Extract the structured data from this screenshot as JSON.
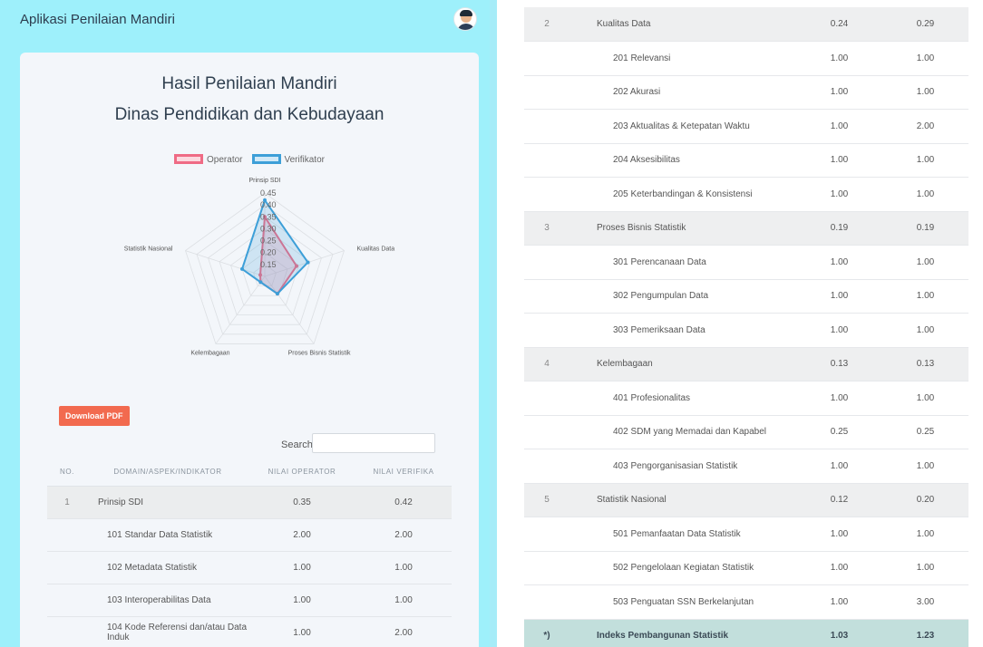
{
  "app": {
    "title": "Aplikasi Penilaian Mandiri"
  },
  "header": {
    "title_line1": "Hasil Penilaian Mandiri",
    "title_line2": "Dinas Pendidikan dan Kebudayaan"
  },
  "chart_data": {
    "type": "radar",
    "categories": [
      "Prinsip SDI",
      "Kualitas Data",
      "Proses Bisnis Statistik",
      "Kelembagaan",
      "Statistik Nasional"
    ],
    "series": [
      {
        "name": "Operator",
        "values": [
          0.35,
          0.24,
          0.19,
          0.13,
          0.12
        ],
        "color": "#ef6b85"
      },
      {
        "name": "Verifikator",
        "values": [
          0.42,
          0.29,
          0.19,
          0.13,
          0.2
        ],
        "color": "#3d9fd8"
      }
    ],
    "r_ticks": [
      "0.45",
      "0.40",
      "0.35",
      "0.30",
      "0.25",
      "0.20",
      "0.15"
    ],
    "r_range": [
      0.1,
      0.45
    ],
    "legend_position": "top"
  },
  "toolbar": {
    "download_label": "Download PDF",
    "search_label": "Search:"
  },
  "table": {
    "headers": [
      "NO.",
      "DOMAIN/ASPEK/INDIKATOR",
      "NILAI OPERATOR",
      "NILAI VERIFIKA"
    ],
    "left_rows": [
      {
        "type": "domain",
        "no": "1",
        "name": "Prinsip SDI",
        "op": "0.35",
        "ver": "0.42"
      },
      {
        "type": "sub",
        "no": "",
        "name": "101 Standar Data Statistik",
        "op": "2.00",
        "ver": "2.00"
      },
      {
        "type": "sub",
        "no": "",
        "name": "102 Metadata Statistik",
        "op": "1.00",
        "ver": "1.00"
      },
      {
        "type": "sub",
        "no": "",
        "name": "103 Interoperabilitas Data",
        "op": "1.00",
        "ver": "1.00"
      },
      {
        "type": "sub",
        "no": "",
        "name": "104 Kode Referensi dan/atau Data Induk",
        "op": "1.00",
        "ver": "2.00"
      }
    ],
    "right_rows": [
      {
        "type": "domain",
        "no": "2",
        "name": "Kualitas Data",
        "op": "0.24",
        "ver": "0.29"
      },
      {
        "type": "sub",
        "no": "",
        "name": "201 Relevansi",
        "op": "1.00",
        "ver": "1.00"
      },
      {
        "type": "sub",
        "no": "",
        "name": "202 Akurasi",
        "op": "1.00",
        "ver": "1.00"
      },
      {
        "type": "sub",
        "no": "",
        "name": "203 Aktualitas & Ketepatan Waktu",
        "op": "1.00",
        "ver": "2.00"
      },
      {
        "type": "sub",
        "no": "",
        "name": "204 Aksesibilitas",
        "op": "1.00",
        "ver": "1.00"
      },
      {
        "type": "sub",
        "no": "",
        "name": "205 Keterbandingan & Konsistensi",
        "op": "1.00",
        "ver": "1.00"
      },
      {
        "type": "domain",
        "no": "3",
        "name": "Proses Bisnis Statistik",
        "op": "0.19",
        "ver": "0.19"
      },
      {
        "type": "sub",
        "no": "",
        "name": "301 Perencanaan Data",
        "op": "1.00",
        "ver": "1.00"
      },
      {
        "type": "sub",
        "no": "",
        "name": "302 Pengumpulan Data",
        "op": "1.00",
        "ver": "1.00"
      },
      {
        "type": "sub",
        "no": "",
        "name": "303 Pemeriksaan Data",
        "op": "1.00",
        "ver": "1.00"
      },
      {
        "type": "domain",
        "no": "4",
        "name": "Kelembagaan",
        "op": "0.13",
        "ver": "0.13"
      },
      {
        "type": "sub",
        "no": "",
        "name": "401 Profesionalitas",
        "op": "1.00",
        "ver": "1.00"
      },
      {
        "type": "sub",
        "no": "",
        "name": "402 SDM yang Memadai dan Kapabel",
        "op": "0.25",
        "ver": "0.25"
      },
      {
        "type": "sub",
        "no": "",
        "name": "403 Pengorganisasian Statistik",
        "op": "1.00",
        "ver": "1.00"
      },
      {
        "type": "domain",
        "no": "5",
        "name": "Statistik Nasional",
        "op": "0.12",
        "ver": "0.20"
      },
      {
        "type": "sub",
        "no": "",
        "name": "501 Pemanfaatan Data Statistik",
        "op": "1.00",
        "ver": "1.00"
      },
      {
        "type": "sub",
        "no": "",
        "name": "502 Pengelolaan Kegiatan Statistik",
        "op": "1.00",
        "ver": "1.00"
      },
      {
        "type": "sub",
        "no": "",
        "name": "503 Penguatan SSN Berkelanjutan",
        "op": "1.00",
        "ver": "3.00"
      },
      {
        "type": "total",
        "no": "*)",
        "name": "Indeks Pembangunan Statistik",
        "op": "1.03",
        "ver": "1.23"
      }
    ]
  }
}
